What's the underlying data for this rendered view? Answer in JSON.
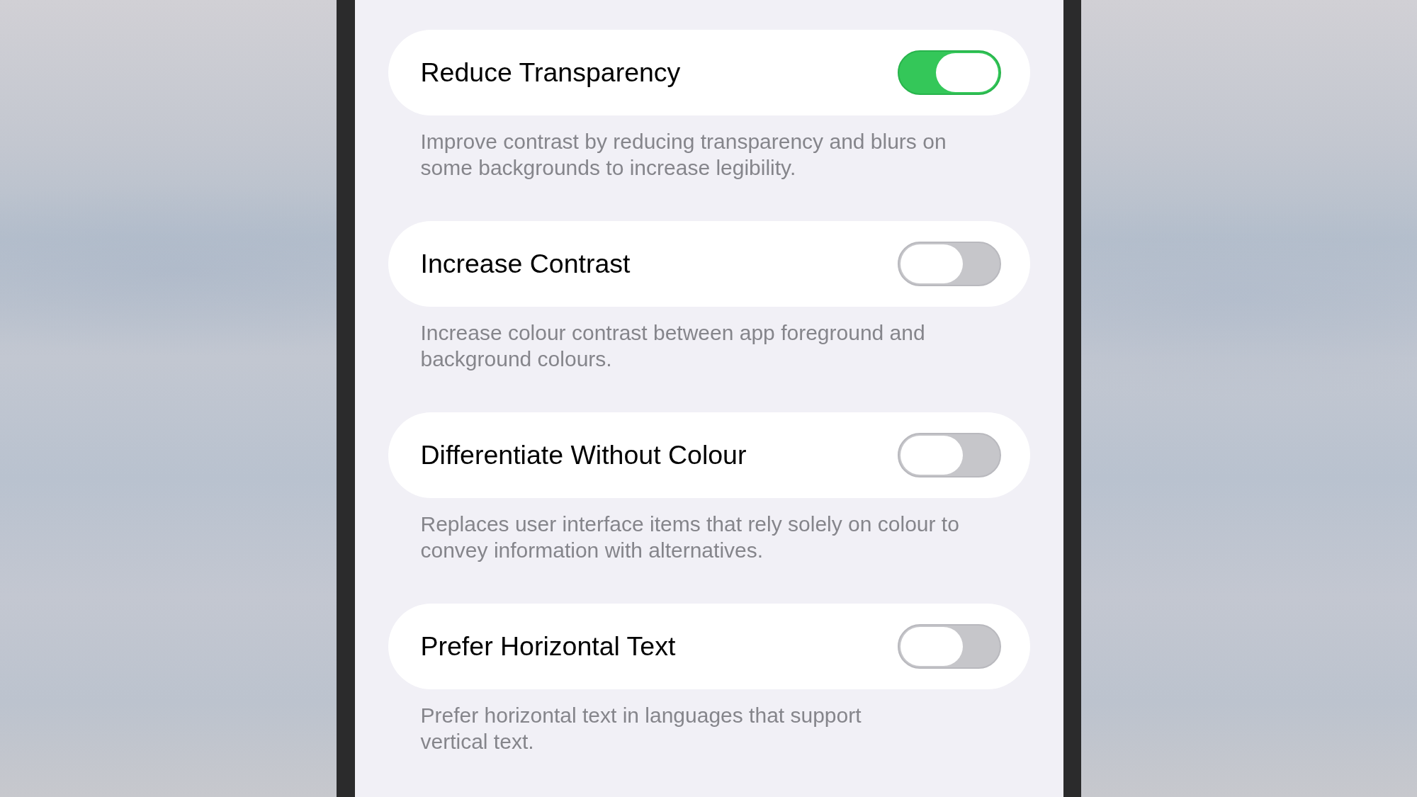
{
  "settings": [
    {
      "title": "Reduce Transparency",
      "on": true,
      "description": "Improve contrast by reducing transparency and blurs on some backgrounds to increase legibility."
    },
    {
      "title": "Increase Contrast",
      "on": false,
      "description": "Increase colour contrast between app foreground and background colours."
    },
    {
      "title": "Differentiate Without Colour",
      "on": false,
      "description": "Replaces user interface items that rely solely on colour to convey information with alternatives."
    },
    {
      "title": "Prefer Horizontal Text",
      "on": false,
      "description": "Prefer horizontal text in languages that support vertical text."
    }
  ]
}
